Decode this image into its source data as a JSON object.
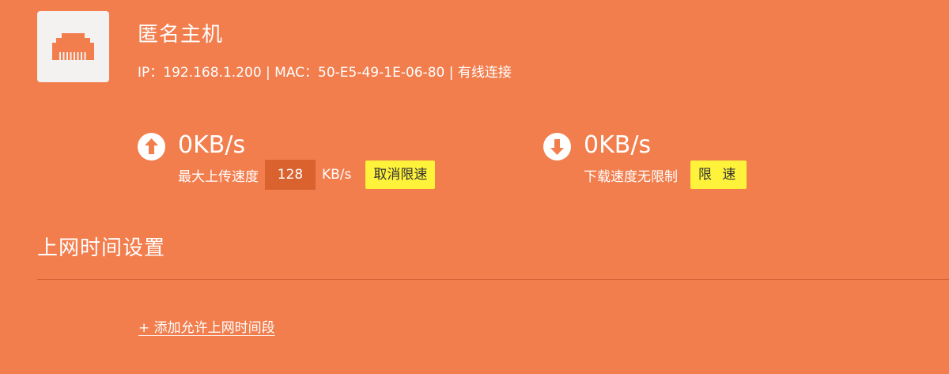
{
  "device": {
    "name": "匿名主机",
    "info": "IP：192.168.1.200 | MAC：50-E5-49-1E-06-80 | 有线连接",
    "icon": "ethernet-port-icon"
  },
  "upload": {
    "icon": "arrow-up-icon",
    "speed": "0KB/s",
    "limit_label": "最大上传速度",
    "limit_value": "128",
    "unit": "KB/s",
    "button_label": "取消限速"
  },
  "download": {
    "icon": "arrow-down-icon",
    "speed": "0KB/s",
    "limit_label": "下载速度无限制",
    "button_label": "限 速"
  },
  "schedule": {
    "title": "上网时间设置",
    "add_link": "+ 添加允许上网时间段"
  },
  "colors": {
    "background": "#f27e4e",
    "icon_box": "#f3f2f0",
    "button": "#fff23a",
    "input": "#d9622f"
  }
}
